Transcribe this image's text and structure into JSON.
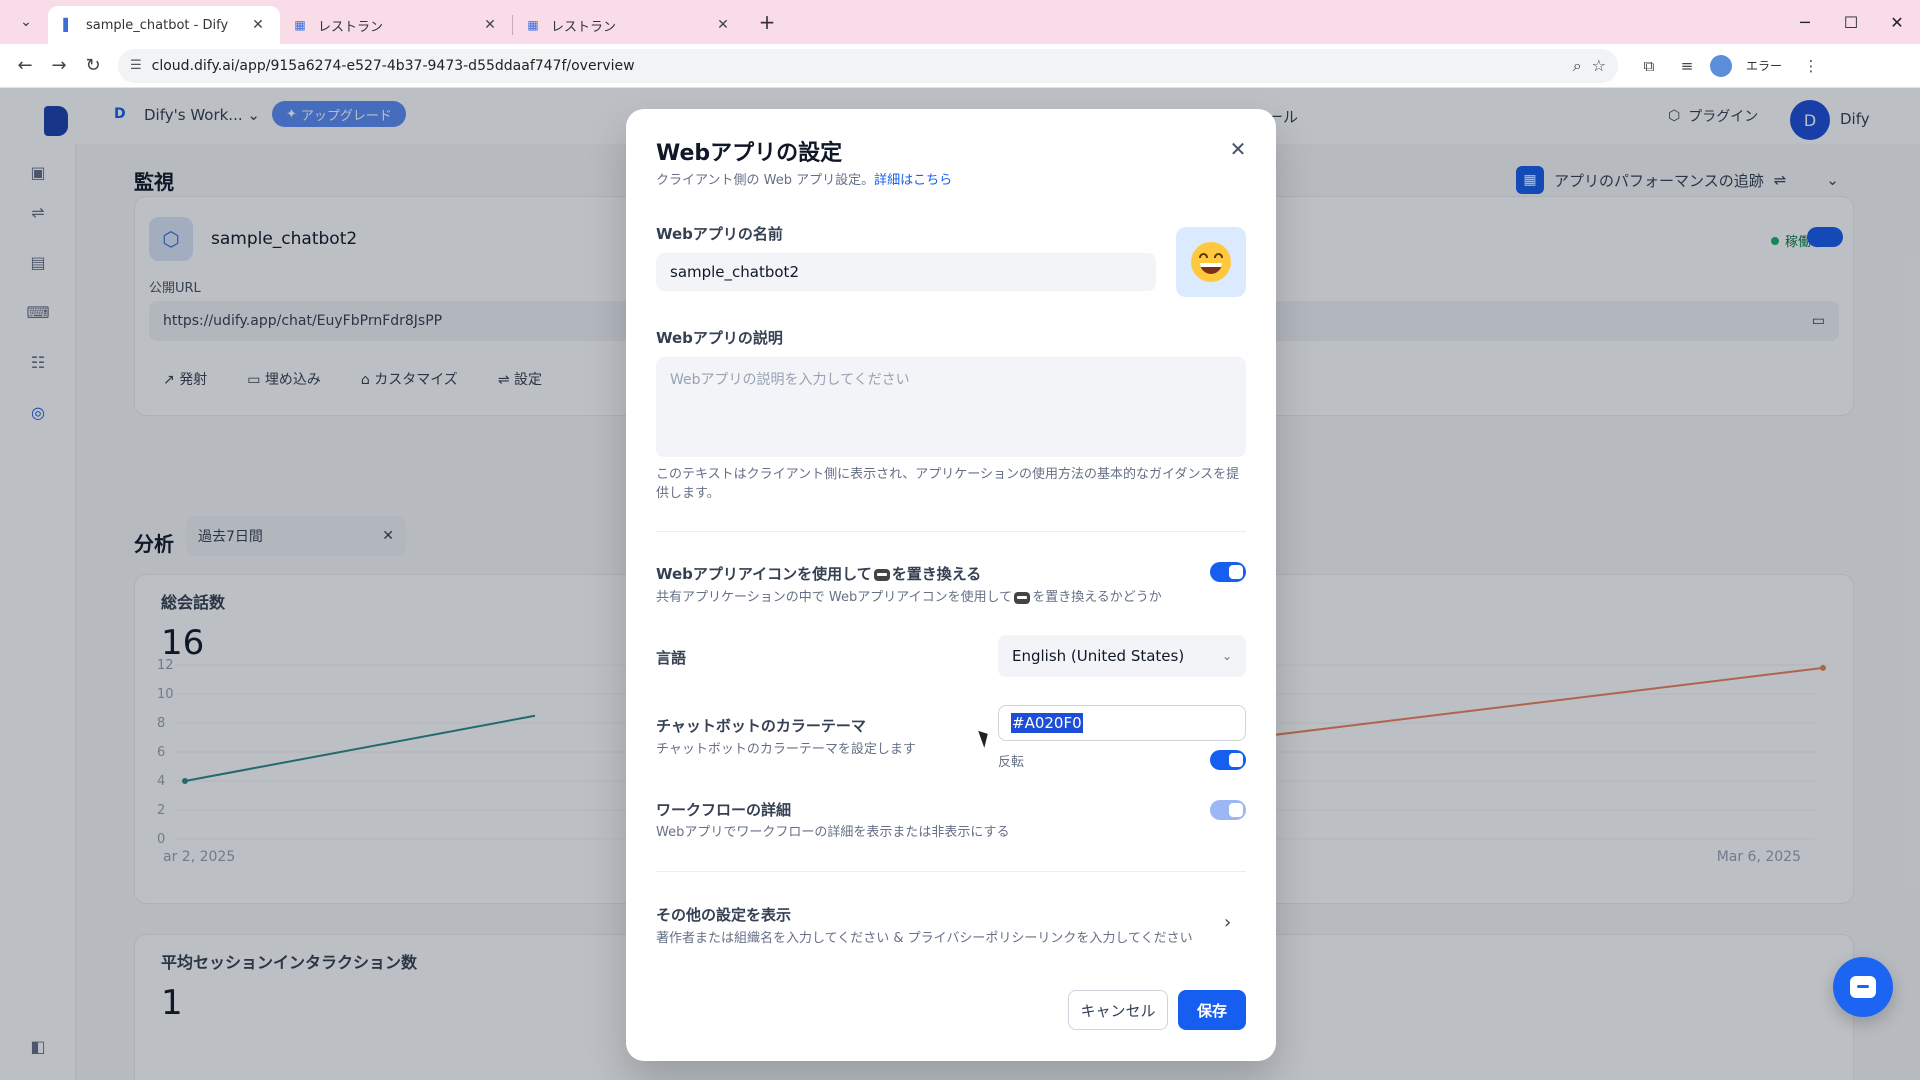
{
  "browser": {
    "tabs": [
      {
        "title": "sample_chatbot - Dify",
        "active": true
      },
      {
        "title": "レストラン",
        "active": false
      },
      {
        "title": "レストラン",
        "active": false
      }
    ],
    "url": "cloud.dify.ai/app/915a6274-e527-4b37-9473-d55ddaaf747f/overview",
    "error_label": "エラー"
  },
  "app": {
    "workspace_initial": "D",
    "workspace_name": "Dify's Work...",
    "upgrade_label": "アップグレード",
    "tools_label_fragment": "ール",
    "plugin_label": "プラグイン",
    "user_initial": "D",
    "user_name": "Dify",
    "monitoring_title": "監視",
    "perf_tracking_label": "アプリのパフォーマンスの追跡",
    "app_name": "sample_chatbot2",
    "status_label": "稼働中",
    "public_url_label": "公開URL",
    "public_url": "https://udify.app/chat/EuyFbPrnFdr8JsPP",
    "card_actions": [
      "発射",
      "埋め込み",
      "カスタマイズ",
      "設定"
    ],
    "analytics_title": "分析",
    "analytics_range": "過去7日間",
    "chart1_title": "総会話数",
    "chart1_value": "16",
    "chart2_title": "平均セッションインタラクション数",
    "chart2_value": "1"
  },
  "chart_data": {
    "type": "line",
    "title": "総会話数",
    "y_ticks": [
      "12",
      "10",
      "8",
      "6",
      "4",
      "2",
      "0"
    ],
    "x_labels": [
      "ar 2, 2025",
      "Mar 6, 2025"
    ],
    "ylim": [
      0,
      12
    ]
  },
  "modal": {
    "title": "Webアプリの設定",
    "subtitle": "クライアント側の Web アプリ設定。",
    "subtitle_link": "詳細はこちら",
    "name_label": "Webアプリの名前",
    "name_value": "sample_chatbot2",
    "desc_label": "Webアプリの説明",
    "desc_placeholder": "Webアプリの説明を入力してください",
    "desc_hint": "このテキストはクライアント側に表示され、アプリケーションの使用方法の基本的なガイダンスを提供します。",
    "icon_replace_label_a": "Webアプリアイコンを使用して",
    "icon_replace_label_b": "を置き換える",
    "icon_replace_hint_a": "共有アプリケーションの中で Webアプリアイコンを使用して",
    "icon_replace_hint_b": "を置き換えるかどうか",
    "language_label": "言語",
    "language_value": "English (United States)",
    "color_theme_label": "チャットボットのカラーテーマ",
    "color_theme_hint": "チャットボットのカラーテーマを設定します",
    "color_value": "#A020F0",
    "invert_label": "反転",
    "workflow_label": "ワークフローの詳細",
    "workflow_hint": "Webアプリでワークフローの詳細を表示または非表示にする",
    "more_label": "その他の設定を表示",
    "more_hint": "著作者または組織名を入力してください & プライバシーポリシーリンクを入力してください",
    "cancel_label": "キャンセル",
    "save_label": "保存"
  },
  "colors": {
    "primary": "#155EEF",
    "line_teal": "#2b8a8a",
    "line_orange": "#f0825a"
  }
}
